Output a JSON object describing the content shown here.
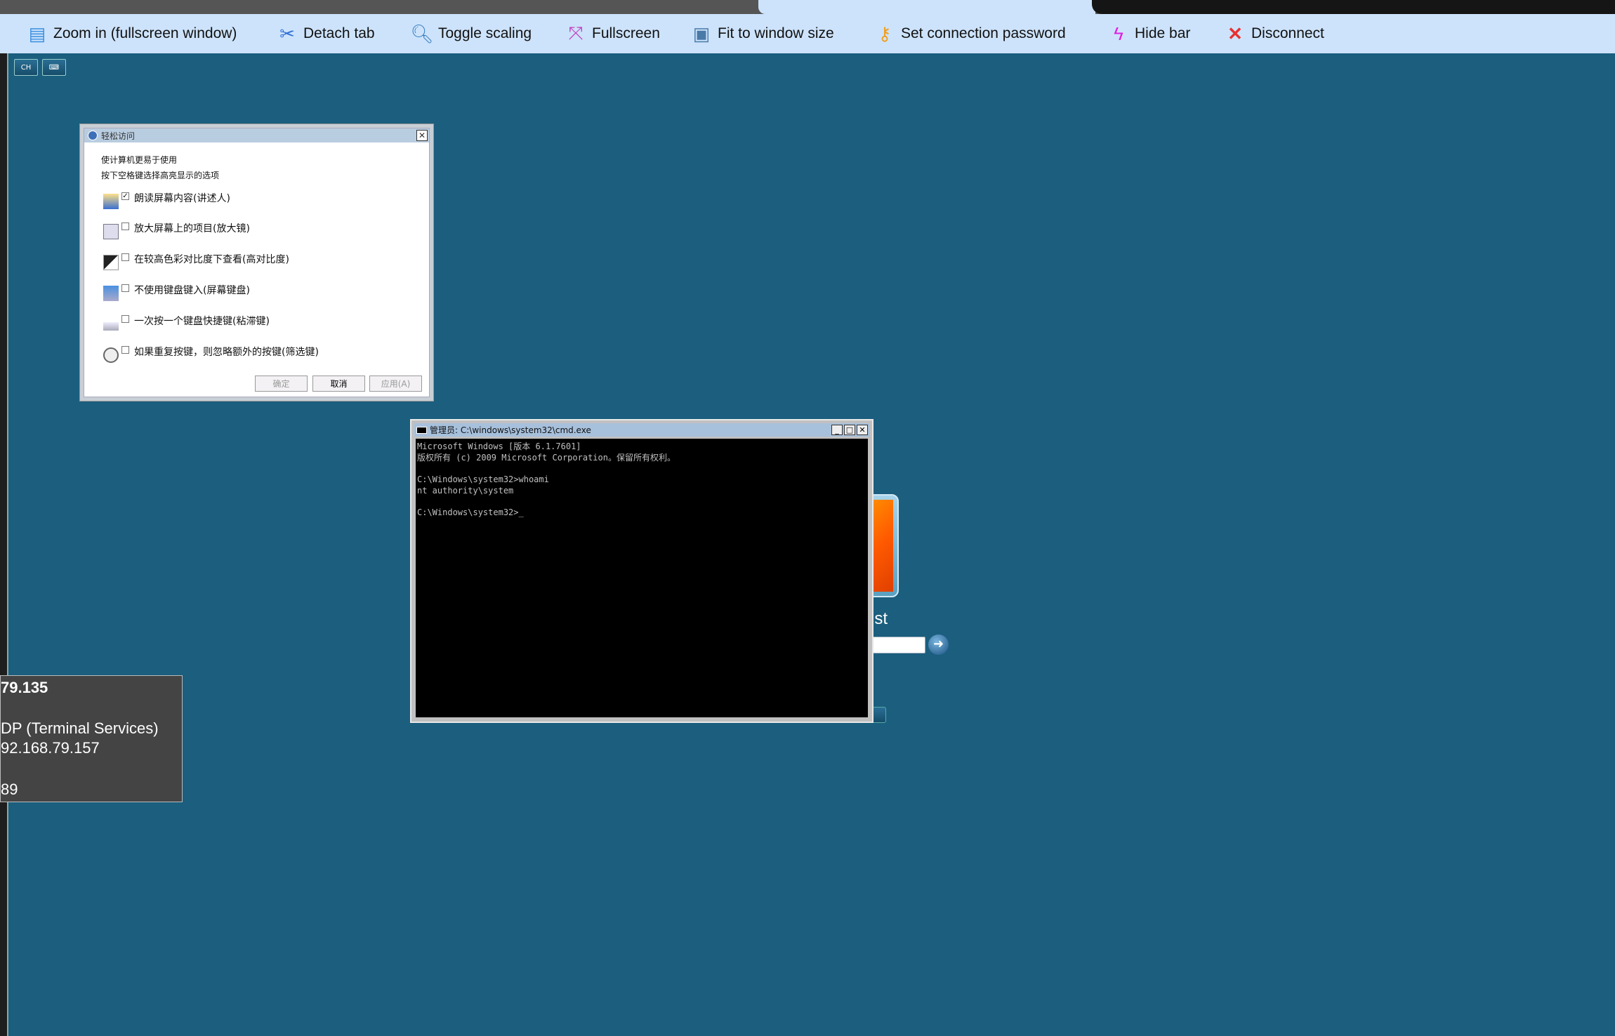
{
  "toolbar": {
    "items": [
      {
        "label": "Zoom in (fullscreen window)",
        "icon": "zoom-page-icon",
        "color": "#3b8fe0"
      },
      {
        "label": "Detach tab",
        "icon": "scissors-icon",
        "color": "#2f6fd6"
      },
      {
        "label": "Toggle scaling",
        "icon": "magnifier-icon",
        "color": "#3a7fc4"
      },
      {
        "label": "Fullscreen",
        "icon": "fullscreen-arrows-icon",
        "color": "#c040c0"
      },
      {
        "label": "Fit to window size",
        "icon": "monitor-icon",
        "color": "#4a7aa8"
      },
      {
        "label": "Set connection password",
        "icon": "key-icon",
        "color": "#f0a020"
      },
      {
        "label": "Hide bar",
        "icon": "lightning-icon",
        "color": "#e020e0"
      },
      {
        "label": "Disconnect",
        "icon": "red-x-icon",
        "color": "#e83030"
      }
    ]
  },
  "small_buttons": {
    "lang": "CH",
    "keyboard": "keyboard-icon"
  },
  "ease_dialog": {
    "title": "轻松访问",
    "heading": "使计算机更易于使用",
    "instruction": "按下空格键选择高亮显示的选项",
    "options": [
      {
        "label": "朗读屏幕内容(讲述人)",
        "checked": true
      },
      {
        "label": "放大屏幕上的项目(放大镜)",
        "checked": false
      },
      {
        "label": "在较高色彩对比度下查看(高对比度)",
        "checked": false
      },
      {
        "label": "不使用键盘键入(屏幕键盘)",
        "checked": false
      },
      {
        "label": "一次按一个键盘快捷键(粘滞键)",
        "checked": false
      },
      {
        "label": "如果重复按键，则忽略额外的按键(筛选键)",
        "checked": false
      }
    ],
    "ok": "确定",
    "cancel": "取消",
    "apply": "应用(A)"
  },
  "cmd": {
    "title": "管理员: C:\\windows\\system32\\cmd.exe",
    "lines": [
      "Microsoft Windows [版本 6.1.7601]",
      "版权所有 (c) 2009 Microsoft Corporation。保留所有权利。",
      "",
      "C:\\Windows\\system32>whoami",
      "nt authority\\system",
      "",
      "C:\\Windows\\system32>_"
    ]
  },
  "login": {
    "username_fragment": "st"
  },
  "tooltip": {
    "lines": [
      "79.135",
      "DP (Terminal Services)",
      "92.168.79.157",
      "89"
    ]
  }
}
